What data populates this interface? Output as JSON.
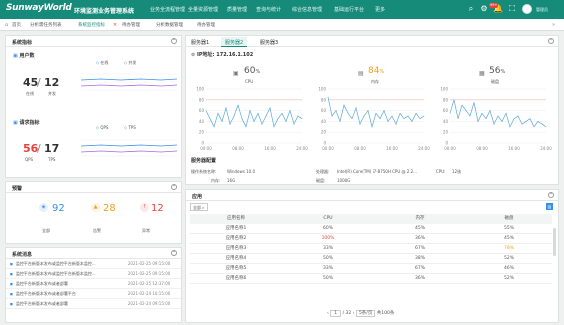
{
  "topbar": {
    "brand": "SunwayWorld",
    "system_title": "环境监测业务管理系统",
    "nav": [
      "业务全流程管理",
      "全量资源管理",
      "质量管理",
      "查询与统计",
      "综合信息管理",
      "基础运行平台",
      "更多"
    ],
    "notification_count": "99+",
    "username": "管理员"
  },
  "tabs": [
    "首页",
    "分析需任务列表",
    "系统监控指标",
    "待办管理",
    "分析数据管理",
    "待办管理"
  ],
  "active_tab": 2,
  "sysmetrics": {
    "title": "系统指标",
    "users": {
      "title": "用户数",
      "online_label": "在线",
      "concurrent_label": "并发",
      "online": "45",
      "concurrent": "12",
      "legend_online": "在线",
      "legend_concurrent": "并发"
    },
    "requests": {
      "title": "请求指标",
      "qps_label": "QPS",
      "tps_label": "TPS",
      "qps": "56",
      "tps": "17",
      "legend_qps": "QPS",
      "legend_tps": "TPS"
    }
  },
  "alerts": {
    "title": "预警",
    "items": [
      {
        "label": "全部",
        "value": "92",
        "color": "#3a8ee6"
      },
      {
        "label": "告警",
        "value": "28",
        "color": "#f0a020"
      },
      {
        "label": "异常",
        "value": "12",
        "color": "#e8423f"
      }
    ]
  },
  "messages": {
    "title": "系统消息",
    "items": [
      {
        "text": "监控平台新版本发布或监控平台新版本监控...",
        "time": "2021-02-25 09:15:00"
      },
      {
        "text": "监控平台新版本发布或监控平台新版本监控...",
        "time": "2021-02-25 09:15:00"
      },
      {
        "text": "监控平台新版本发布或者部署",
        "time": "2021-02-25 12:37:00"
      },
      {
        "text": "监控平台新版本发布或者部署平台",
        "time": "2021-02-24 10:15:00"
      },
      {
        "text": "监控平台新版本发布或者部署",
        "time": "2021-02-24 09:15:00"
      }
    ]
  },
  "servers": {
    "tabs": [
      "服务器1",
      "服务器2",
      "服务器3"
    ],
    "active": 1,
    "ip_label": "IP地址:",
    "ip": "172.16.1.102",
    "cpu": {
      "value": "60",
      "unit": "%",
      "label": "CPU"
    },
    "mem": {
      "value": "84",
      "unit": "%",
      "label": "内存"
    },
    "disk": {
      "value": "56",
      "unit": "%",
      "label": "磁盘"
    },
    "config_title": "服务器配置",
    "config": [
      {
        "k": "操作系统名称:",
        "v": "Windows 10.0"
      },
      {
        "k": "处理器:",
        "v": "Intel(R) Core(TM) i7-8750H CPU @ 2.2..."
      },
      {
        "k": "CPU:",
        "v": "12核"
      },
      {
        "k": "内存:",
        "v": "16G"
      },
      {
        "k": "磁盘:",
        "v": "1000G"
      }
    ]
  },
  "chart_data": [
    {
      "type": "line",
      "title": "CPU",
      "x": [
        "00:00",
        "08:00",
        "16:00",
        "24:00"
      ],
      "ylim": [
        0,
        100
      ],
      "yticks": [
        "100",
        "80",
        "60",
        "40",
        "20",
        "0"
      ],
      "values": [
        60,
        45,
        30,
        55,
        40,
        65,
        35,
        50,
        70,
        45,
        30,
        60,
        40,
        55,
        35,
        50,
        65,
        30,
        45,
        55,
        40,
        60,
        35,
        50,
        45
      ],
      "color": "#5aa9d6"
    },
    {
      "type": "line",
      "title": "内存",
      "x": [
        "00:00",
        "08:00",
        "16:00",
        "24:00"
      ],
      "ylim": [
        0,
        100
      ],
      "yticks": [
        "100",
        "80",
        "60",
        "40",
        "20",
        "0"
      ],
      "values": [
        85,
        50,
        60,
        40,
        70,
        55,
        45,
        65,
        35,
        50,
        60,
        30,
        55,
        45,
        60,
        40,
        50,
        35,
        55,
        45,
        50,
        40,
        55,
        45,
        50
      ],
      "color": "#5aa9d6"
    },
    {
      "type": "line",
      "title": "磁盘",
      "x": [
        "00:00",
        "08:00",
        "16:00",
        "24:00"
      ],
      "ylim": [
        0,
        100
      ],
      "yticks": [
        "100",
        "80",
        "60",
        "40",
        "20",
        "0"
      ],
      "values": [
        55,
        80,
        45,
        70,
        60,
        50,
        75,
        40,
        55,
        45,
        60,
        35,
        50,
        40,
        55,
        30,
        45,
        50,
        35,
        40,
        45,
        30,
        40,
        35,
        30
      ],
      "color": "#5aa9d6"
    }
  ],
  "apps": {
    "title": "应用",
    "filter": "全部",
    "columns": [
      "应用名称",
      "CPU",
      "内存",
      "磁盘"
    ],
    "rows": [
      {
        "name": "应用名称1",
        "cpu": "60%",
        "mem": "45%",
        "disk": "55%",
        "cpu_hl": false,
        "disk_hl": false
      },
      {
        "name": "应用名称2",
        "cpu": "100%",
        "mem": "36%",
        "disk": "45%",
        "cpu_hl": true,
        "disk_hl": false
      },
      {
        "name": "应用名称3",
        "cpu": "33%",
        "mem": "67%",
        "disk": "78%",
        "cpu_hl": false,
        "disk_hl": true
      },
      {
        "name": "应用名称4",
        "cpu": "50%",
        "mem": "38%",
        "disk": "52%",
        "cpu_hl": false,
        "disk_hl": false
      },
      {
        "name": "应用名称5",
        "cpu": "33%",
        "mem": "67%",
        "disk": "46%",
        "cpu_hl": false,
        "disk_hl": false
      },
      {
        "name": "应用名称6",
        "cpu": "50%",
        "mem": "36%",
        "disk": "52%",
        "cpu_hl": false,
        "disk_hl": false
      }
    ],
    "pagination": {
      "page": "1",
      "total_pages": "/ 32",
      "page_size": "5条/页",
      "total": "共100条"
    }
  }
}
